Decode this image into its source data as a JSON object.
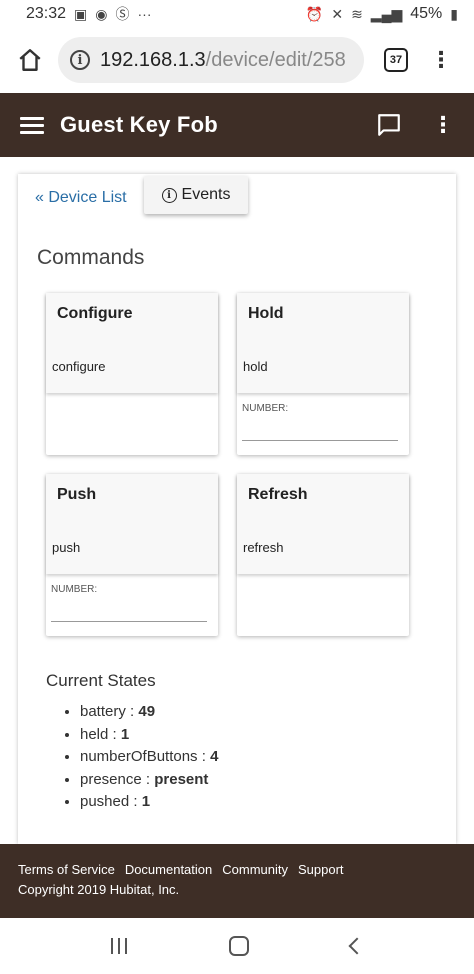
{
  "status_bar": {
    "time": "23:32",
    "battery": "45%",
    "left_icons": [
      "image-icon",
      "location-icon",
      "skype-icon",
      "more-icon"
    ],
    "right_icons": [
      "alarm-icon",
      "mute-icon",
      "wifi-icon",
      "signal-icon",
      "battery-icon"
    ]
  },
  "browser": {
    "url_host": "192.168.1.3",
    "url_path": "/device/edit/258",
    "tab_count": "37"
  },
  "header": {
    "title": "Guest Key Fob"
  },
  "nav": {
    "device_list_link": "« Device List",
    "events_button": "Events"
  },
  "commands": {
    "title": "Commands",
    "items": [
      {
        "name": "Configure",
        "method": "configure",
        "param_label": ""
      },
      {
        "name": "Hold",
        "method": "hold",
        "param_label": "NUMBER:"
      },
      {
        "name": "Push",
        "method": "push",
        "param_label": "NUMBER:"
      },
      {
        "name": "Refresh",
        "method": "refresh",
        "param_label": ""
      }
    ]
  },
  "current_states": {
    "title": "Current States",
    "items": [
      {
        "key": "battery",
        "value": "49"
      },
      {
        "key": "held",
        "value": "1"
      },
      {
        "key": "numberOfButtons",
        "value": "4"
      },
      {
        "key": "presence",
        "value": "present"
      },
      {
        "key": "pushed",
        "value": "1"
      }
    ]
  },
  "footer": {
    "links": [
      "Terms of Service",
      "Documentation",
      "Community",
      "Support"
    ],
    "copyright": "Copyright 2019 Hubitat, Inc."
  },
  "colors": {
    "header_bg": "#3e2e26",
    "link": "#2a6ea6"
  }
}
